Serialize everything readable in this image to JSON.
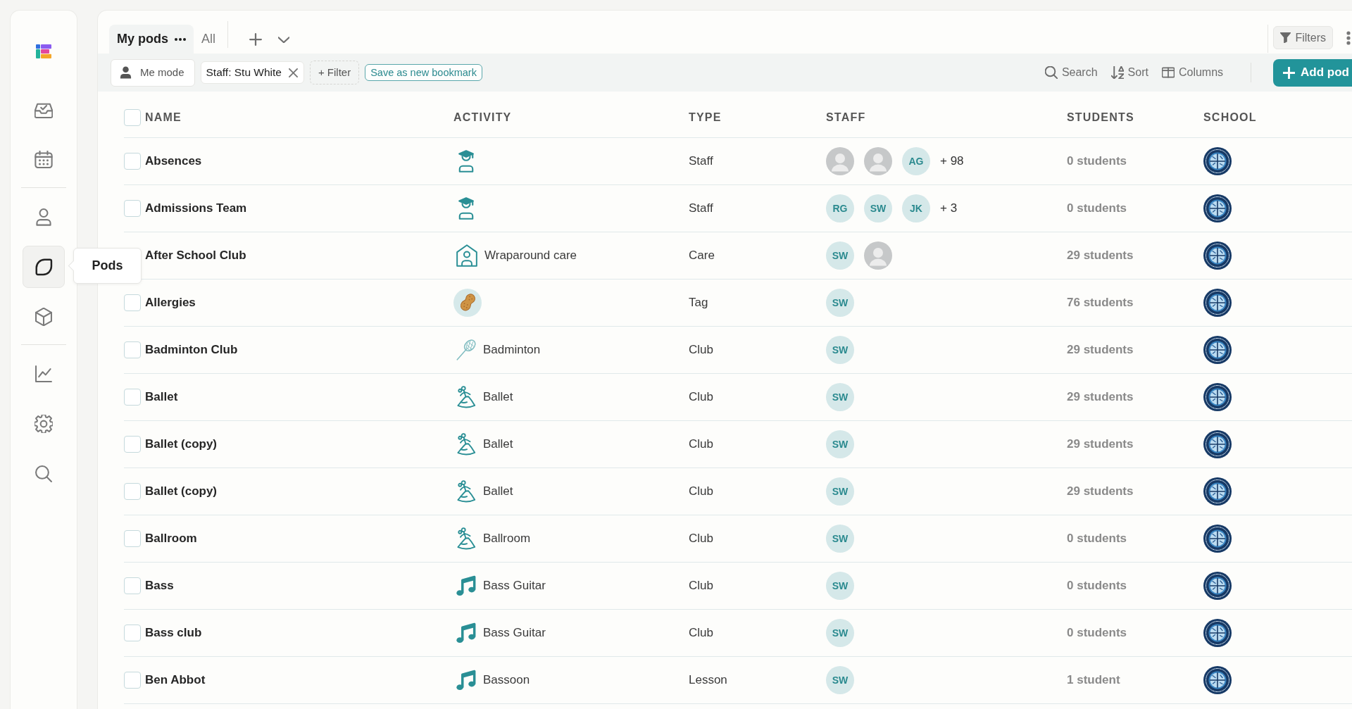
{
  "sidebar": {
    "sections": [
      {
        "items": [
          {
            "kind": "inbox",
            "selected": false
          },
          {
            "kind": "calendar",
            "selected": false
          }
        ]
      },
      {
        "items": [
          {
            "kind": "people",
            "selected": false
          },
          {
            "kind": "pods",
            "selected": true,
            "tooltip": "Pods"
          },
          {
            "kind": "products",
            "selected": false
          }
        ]
      },
      {
        "items": [
          {
            "kind": "reports",
            "selected": false
          },
          {
            "kind": "settings",
            "selected": false
          },
          {
            "kind": "search",
            "selected": false
          }
        ]
      }
    ]
  },
  "tabs": [
    {
      "label": "My pods",
      "selected": true
    },
    {
      "label": "All",
      "selected": false
    }
  ],
  "view_toolbar": {
    "filters_button": "Filters"
  },
  "filter_bar": {
    "me_mode": "Me mode",
    "chips": [
      {
        "label": "Staff: Stu White"
      }
    ],
    "add_filter": "+ Filter",
    "bookmark_button": "Save as new bookmark",
    "tools": [
      {
        "kind": "search",
        "label": "Search"
      },
      {
        "kind": "sort",
        "label": "Sort"
      },
      {
        "kind": "columns",
        "label": "Columns"
      }
    ],
    "add_button": "Add pod"
  },
  "table": {
    "columns": [
      "NAME",
      "ACTIVITY",
      "TYPE",
      "STAFF",
      "STUDENTS",
      "SCHOOL"
    ],
    "select_all": {
      "checked": false
    },
    "rows": [
      {
        "name": "Absences",
        "checked": false,
        "activity": {
          "kind": "teacher"
        },
        "type": "Staff",
        "staff": [
          {
            "kind": "photo"
          },
          {
            "kind": "photo"
          },
          {
            "kind": "initials",
            "initials": "AG"
          }
        ],
        "staff_more": "+ 98",
        "students": "0 students"
      },
      {
        "name": "Admissions Team",
        "checked": false,
        "activity": {
          "kind": "teacher"
        },
        "type": "Staff",
        "staff": [
          {
            "kind": "initials",
            "initials": "RG"
          },
          {
            "kind": "initials",
            "initials": "SW"
          },
          {
            "kind": "initials",
            "initials": "JK"
          }
        ],
        "staff_more": "+ 3",
        "students": "0 students"
      },
      {
        "name": "After School Club",
        "activity": {
          "kind": "care",
          "label": "Wraparound care"
        },
        "type": "Care",
        "staff": [
          {
            "kind": "initials",
            "initials": "SW"
          },
          {
            "kind": "photo"
          }
        ],
        "students": "29 students"
      },
      {
        "name": "Allergies",
        "checked": false,
        "activity": {
          "kind": "peanut"
        },
        "type": "Tag",
        "staff": [
          {
            "kind": "initials",
            "initials": "SW"
          }
        ],
        "students": "76 students"
      },
      {
        "name": "Badminton Club",
        "checked": false,
        "activity": {
          "kind": "badminton",
          "label": "Badminton"
        },
        "type": "Club",
        "staff": [
          {
            "kind": "initials",
            "initials": "SW"
          }
        ],
        "students": "29 students"
      },
      {
        "name": "Ballet",
        "checked": false,
        "activity": {
          "kind": "dance",
          "label": "Ballet"
        },
        "type": "Club",
        "staff": [
          {
            "kind": "initials",
            "initials": "SW"
          }
        ],
        "students": "29 students"
      },
      {
        "name": "Ballet (copy)",
        "checked": false,
        "activity": {
          "kind": "dance",
          "label": "Ballet"
        },
        "type": "Club",
        "staff": [
          {
            "kind": "initials",
            "initials": "SW"
          }
        ],
        "students": "29 students"
      },
      {
        "name": "Ballet (copy)",
        "checked": false,
        "activity": {
          "kind": "dance",
          "label": "Ballet"
        },
        "type": "Club",
        "staff": [
          {
            "kind": "initials",
            "initials": "SW"
          }
        ],
        "students": "29 students"
      },
      {
        "name": "Ballroom",
        "checked": false,
        "activity": {
          "kind": "dance",
          "label": "Ballroom"
        },
        "type": "Club",
        "staff": [
          {
            "kind": "initials",
            "initials": "SW"
          }
        ],
        "students": "0 students"
      },
      {
        "name": "Bass",
        "checked": false,
        "activity": {
          "kind": "music",
          "label": "Bass Guitar"
        },
        "type": "Club",
        "staff": [
          {
            "kind": "initials",
            "initials": "SW"
          }
        ],
        "students": "0 students"
      },
      {
        "name": "Bass club",
        "checked": false,
        "activity": {
          "kind": "music",
          "label": "Bass Guitar"
        },
        "type": "Club",
        "staff": [
          {
            "kind": "initials",
            "initials": "SW"
          }
        ],
        "students": "0 students"
      },
      {
        "name": "Ben Abbot",
        "checked": false,
        "activity": {
          "kind": "music",
          "label": "Bassoon"
        },
        "type": "Lesson",
        "staff": [
          {
            "kind": "initials",
            "initials": "SW"
          }
        ],
        "students": "1 student"
      }
    ]
  }
}
